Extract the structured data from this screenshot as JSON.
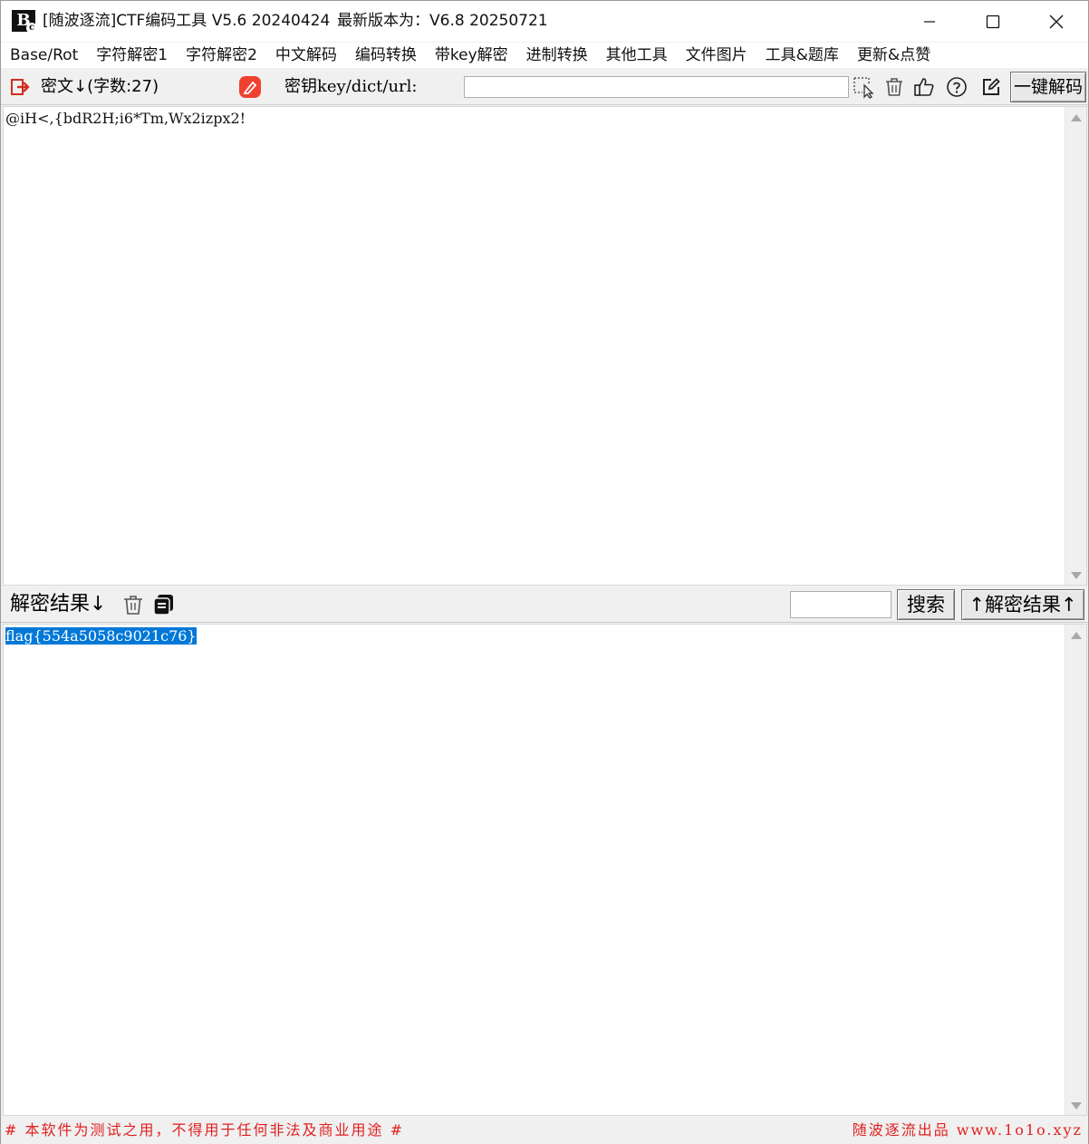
{
  "window": {
    "title": "[随波逐流]CTF编码工具 V5.6 20240424",
    "latest_version": "最新版本为：V6.8 20250721",
    "logo_text": "B"
  },
  "menu": {
    "items": [
      "Base/Rot",
      "字符解密1",
      "字符解密2",
      "中文解码",
      "编码转换",
      "带key解密",
      "进制转换",
      "其他工具",
      "文件图片",
      "工具&题库",
      "更新&点赞"
    ]
  },
  "toolbar": {
    "cipher_label": "密文↓(字数:27)",
    "key_label": "密钥key/dict/url:",
    "key_value": "",
    "decode_button": "一键解码"
  },
  "cipher": {
    "text": "@iH<,{bdR2H;i6*Tm,Wx2izpx2!"
  },
  "result_bar": {
    "label": "解密结果↓",
    "search_value": "",
    "search_button": "搜索",
    "encode_button": "↑解密结果↑"
  },
  "result": {
    "text": "flag{554a5058c9021c76}"
  },
  "status": {
    "left": "# 本软件为测试之用，不得用于任何非法及商业用途 #",
    "right": "随波逐流出品 www.1o1o.xyz"
  },
  "colors": {
    "accent_red": "#e02020",
    "selection_blue": "#0078d7",
    "pen_icon_red": "#f04030"
  },
  "icons": [
    "import-icon",
    "clear-pen-icon",
    "select-icon",
    "trash-icon",
    "thumbs-up-icon",
    "help-icon",
    "edit-icon",
    "copy-icon"
  ]
}
